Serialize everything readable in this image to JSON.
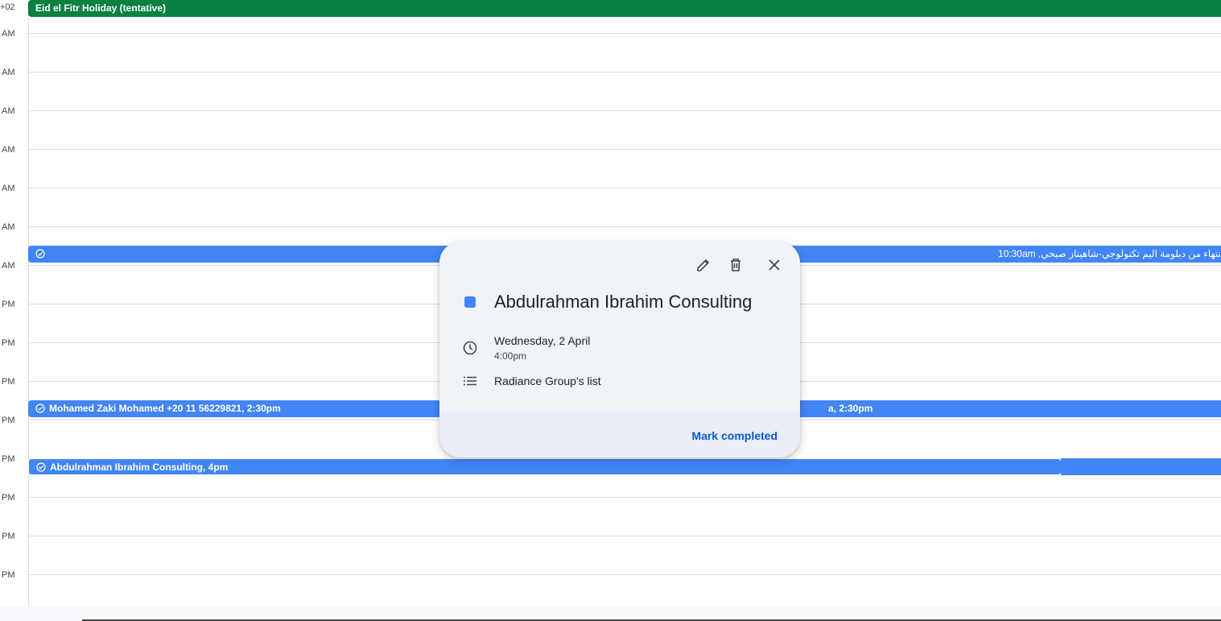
{
  "timezone_label": "+02",
  "allday_event": {
    "title": "Eid el Fitr Holiday (tentative)",
    "color": "#0b8043"
  },
  "hour_labels": [
    "AM",
    "AM",
    "AM",
    "AM",
    "AM",
    "AM",
    "AM",
    "PM",
    "PM",
    "PM",
    "PM",
    "PM",
    "PM",
    "PM",
    "PM"
  ],
  "task_color": "#4285f4",
  "tasks": {
    "rtl_task": {
      "text": "نتهاء من دبلومة اليم تكنولوجي-شاهيناز صبحي, 10:30am"
    },
    "mohamed_task": {
      "text": "Mohamed Zaki Mohamed +20 11 56229821, 2:30pm",
      "overflow_text": "a, 2:30pm"
    },
    "abdulrahman_task": {
      "text": "Abdulrahman Ibrahim Consulting, 4pm"
    }
  },
  "popup": {
    "title": "Abdulrahman Ibrahim Consulting",
    "date": "Wednesday, 2 April",
    "time": "4:00pm",
    "list": "Radiance Group's list",
    "action": "Mark completed",
    "icons": [
      "edit-icon",
      "delete-icon",
      "close-icon",
      "clock-icon",
      "list-icon"
    ]
  }
}
